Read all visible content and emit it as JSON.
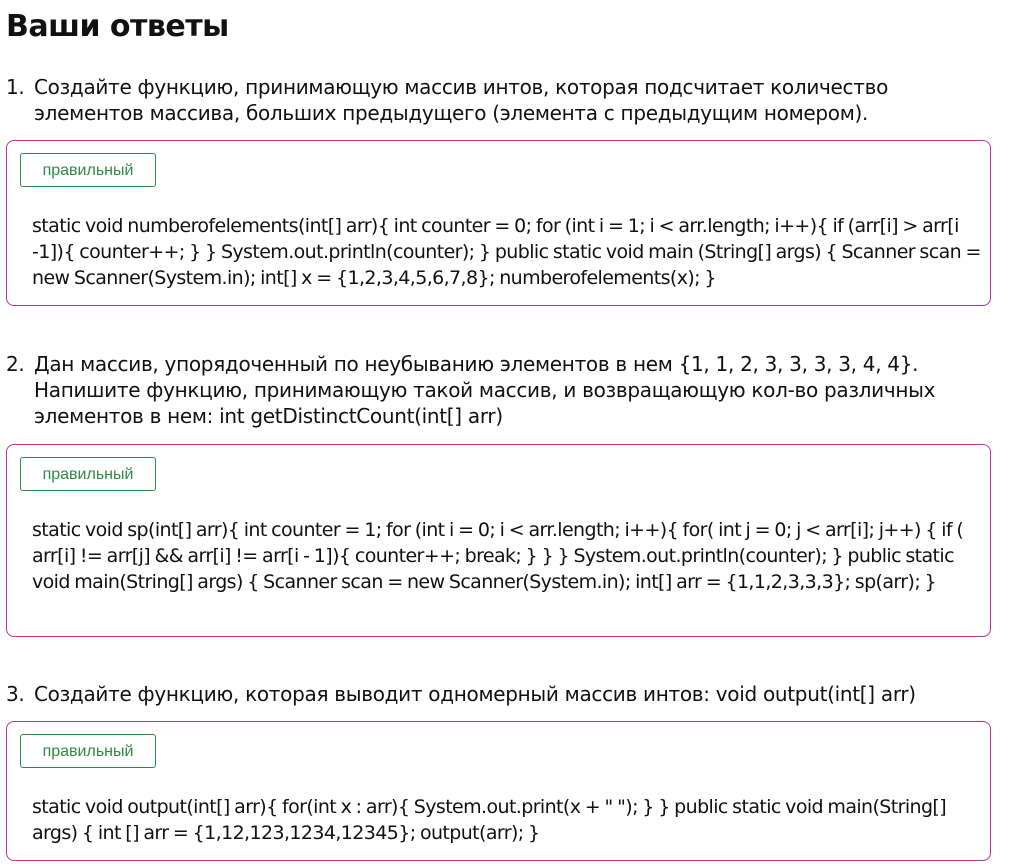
{
  "page": {
    "title": "Ваши ответы"
  },
  "questions": [
    {
      "number": "1.",
      "text": "Создайте функцию, принимающую массив интов, которая подсчитает количество элементов массива, больших предыдущего (элемента с предыдущим номером).",
      "status": "правильный",
      "status_color": "#2f8a45",
      "answer": "static void numberofelements(int[] arr){ int counter = 0; for (int i = 1; i < arr.length; i++){ if (arr[i] > arr[i -1]){ counter++; } } System.out.println(counter); } public static void main (String[] args) { Scanner scan = new Scanner(System.in); int[] x = {1,2,3,4,5,6,7,8}; numberofelements(x); }"
    },
    {
      "number": "2.",
      "text": "Дан массив, упорядоченный по неубыванию элементов в нем {1, 1, 2, 3, 3, 3, 3, 4, 4}. Напишите функцию, принимающую такой массив, и возвращающую кол-во различных элементов в нем: int getDistinctCount(int[] arr)",
      "status": "правильный",
      "status_color": "#2f8a45",
      "answer": "static void sp(int[] arr){ int counter = 1; for (int i = 0; i < arr.length; i++){ for( int j = 0; j < arr[i]; j++) { if ( arr[i] != arr[j] && arr[i] != arr[i - 1]){ counter++; break; } } } System.out.println(counter); } public static void main(String[] args) { Scanner scan = new Scanner(System.in); int[] arr = {1,1,2,3,3,3}; sp(arr); }"
    },
    {
      "number": "3.",
      "text": "Создайте функцию, которая выводит одномерный массив интов: void output(int[] arr)",
      "status": "правильный",
      "status_color": "#2f8a45",
      "answer": "static void output(int[] arr){ for(int x : arr){ System.out.print(x + \" \"); } } public static void main(String[] args) { int [] arr = {1,12,123,1234,12345}; output(arr); }"
    }
  ],
  "colors": {
    "answer_border": "#b0359a",
    "correct_green": "#2f8a45"
  }
}
